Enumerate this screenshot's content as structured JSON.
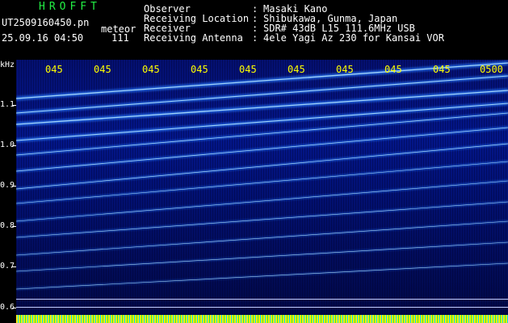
{
  "app_title": "HROFFT",
  "file": {
    "name": "UT2509160450.pn",
    "detector": "meteor",
    "timestamp": "25.09.16 04:50",
    "count": "111"
  },
  "info": {
    "observer_label": "Observer",
    "observer_value": "Masaki Kano",
    "location_label": "Receiving Location",
    "location_value": "Shibukawa, Gunma, Japan",
    "receiver_label": "Receiver",
    "receiver_value": "SDR# 43dB L15 111.6MHz USB",
    "antenna_label": "Receiving Antenna",
    "antenna_value": "4ele Yagi Az 230 for Kansai VOR",
    "colon": ":"
  },
  "y_axis": {
    "unit": "kHz",
    "ticks": [
      "1.1",
      "1.0",
      "0.9",
      "0.8",
      "0.7",
      "0.6"
    ]
  },
  "x_axis": {
    "ticks": [
      "045",
      "045",
      "045",
      "045",
      "045",
      "045",
      "045",
      "045",
      "045",
      "0500"
    ]
  },
  "colors": {
    "title": "#22ee44",
    "axis_labels": "#ffff00",
    "background": "#000000",
    "plot_blue": "#03168a"
  }
}
